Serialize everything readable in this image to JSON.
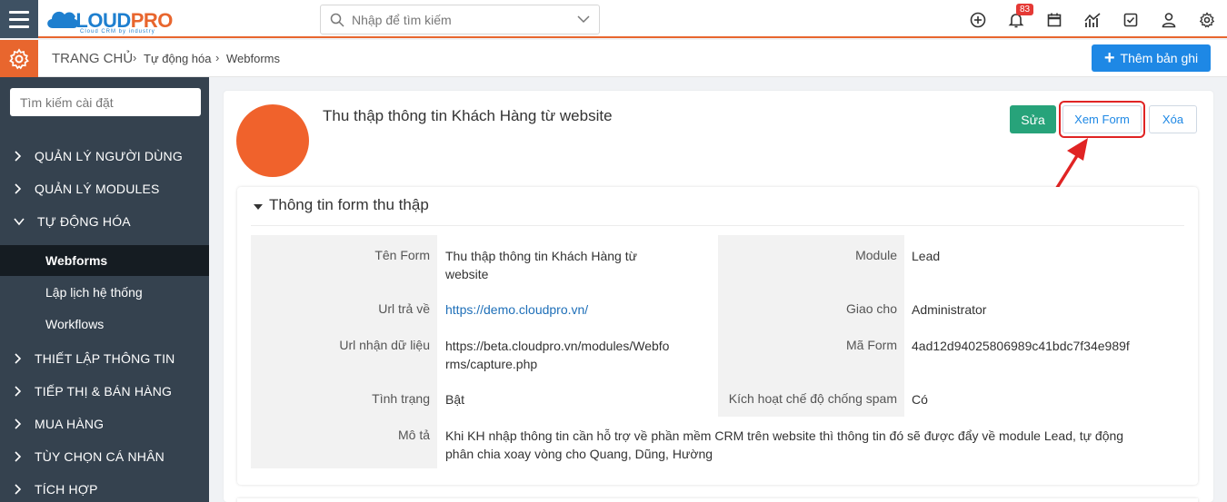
{
  "app": {
    "logo_text_a": "CLOUD",
    "logo_text_b": "PRO",
    "logo_tagline": "Cloud CRM by industry",
    "brand_color": "#e8662e",
    "accent_color": "#1e88e5"
  },
  "search": {
    "placeholder": "Nhập để tìm kiếm"
  },
  "topbar": {
    "icons": [
      "plus-circle-icon",
      "bell-icon",
      "calendar-icon",
      "chart-icon",
      "checkbox-icon",
      "user-icon",
      "gear-icon"
    ],
    "notification_count": "83"
  },
  "breadcrumb": {
    "home": "TRANG CHỦ",
    "items": [
      "Tự động hóa",
      "Webforms"
    ]
  },
  "header_action": {
    "add_label": "Thêm bản ghi"
  },
  "sidebar": {
    "search_placeholder": "Tìm kiếm cài đặt",
    "menu": [
      {
        "label": "QUẢN LÝ NGƯỜI DÙNG",
        "expanded": false
      },
      {
        "label": "QUẢN LÝ MODULES",
        "expanded": false
      },
      {
        "label": "TỰ ĐỘNG HÓA",
        "expanded": true
      },
      {
        "label": "THIẾT LẬP THÔNG TIN",
        "expanded": false
      },
      {
        "label": "TIẾP THỊ & BÁN HÀNG",
        "expanded": false
      },
      {
        "label": "MUA HÀNG",
        "expanded": false
      },
      {
        "label": "TÙY CHỌN CÁ NHÂN",
        "expanded": false
      },
      {
        "label": "TÍCH HỢP",
        "expanded": false
      }
    ],
    "submenu": [
      {
        "label": "Webforms",
        "active": true
      },
      {
        "label": "Lập lịch hệ thống",
        "active": false
      },
      {
        "label": "Workflows",
        "active": false
      }
    ]
  },
  "record": {
    "title": "Thu thập thông tin Khách Hàng từ website",
    "avatar_color": "#f0622c",
    "actions": {
      "edit": "Sửa",
      "view_form": "Xem Form",
      "delete": "Xóa"
    }
  },
  "section": {
    "title": "Thông tin form thu thập",
    "fields_left": [
      {
        "label": "Tên Form",
        "value_lines": [
          "Thu thập thông tin Khách Hàng từ",
          "website"
        ]
      },
      {
        "label": "Url trả về",
        "value_lines": [
          "https://demo.cloudpro.vn/"
        ]
      },
      {
        "label": "Url nhận dữ liệu",
        "value_lines": [
          "https://beta.cloudpro.vn/modules/Webfo",
          "rms/capture.php"
        ]
      },
      {
        "label": "Tình trạng",
        "value_lines": [
          "Bật"
        ]
      },
      {
        "label": "Mô tả",
        "value_lines": [
          "Khi KH nhập thông tin cần hỗ trợ về phần mềm CRM trên website thì thông tin đó sẽ được đẩy về module Lead, tự động",
          "phân chia xoay vòng cho Quang, Dũng, Hường"
        ]
      }
    ],
    "fields_right": [
      {
        "label": "Module",
        "value": "Lead"
      },
      {
        "label": "Giao cho",
        "value": "Administrator"
      },
      {
        "label": "Mã Form",
        "value": "4ad12d94025806989c41bdc7f34e989f"
      },
      {
        "label": "Kích hoạt chế độ chống spam",
        "value": "Có"
      }
    ]
  }
}
